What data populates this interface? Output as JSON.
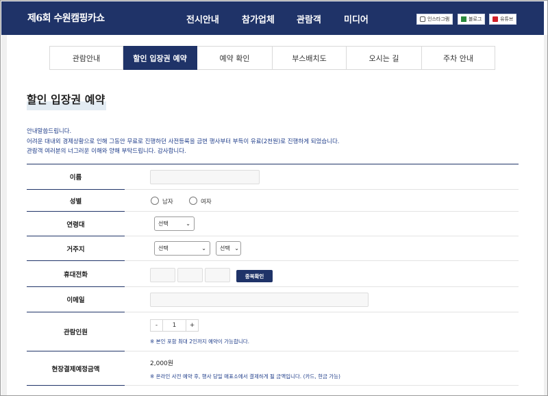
{
  "header": {
    "logo": "제6회 수원캠핑카쇼",
    "nav": [
      "전시안내",
      "참가업체",
      "관람객",
      "미디어"
    ],
    "sns": [
      {
        "label": "인스타그램",
        "icon": "instagram-icon"
      },
      {
        "label": "블로그",
        "icon": "blog-icon"
      },
      {
        "label": "유튜브",
        "icon": "youtube-icon"
      }
    ]
  },
  "tabs": [
    {
      "label": "관람안내",
      "active": false
    },
    {
      "label": "할인 입장권 예약",
      "active": true
    },
    {
      "label": "예약 확인",
      "active": false
    },
    {
      "label": "부스배치도",
      "active": false
    },
    {
      "label": "오시는 길",
      "active": false
    },
    {
      "label": "주차 안내",
      "active": false
    }
  ],
  "page_title": "할인 입장권 예약",
  "notice": [
    "안내말씀드립니다.",
    "어려운 대내외 경제상황으로 인해 그동안 무료로 진행하던 사전등록을 금번 행사부터 부득이 유료(2천원)로 진행하게 되었습니다.",
    "관람객 여러분의 너그러운 이해와 양해 부탁드립니다. 감사합니다."
  ],
  "form": {
    "name_label": "이름",
    "gender_label": "성별",
    "gender_options": [
      "남자",
      "여자"
    ],
    "age_label": "연령대",
    "age_value": "선택",
    "address_label": "거주지",
    "address_city": "선택",
    "address_district": "선택",
    "phone_label": "휴대전화",
    "dup_check": "중복확인",
    "email_label": "이메일",
    "visitors_label": "관람인원",
    "visitors_minus": "-",
    "visitors_value": "1",
    "visitors_plus": "+",
    "visitors_note": "※ 본인 포함 최대 2인까지 예약이 가능합니다.",
    "payment_label": "현장결제예정금액",
    "payment_value": "2,000원",
    "payment_note": "※ 온라인 사전 예약 후, 행사 당일 매표소에서 결제하게 될 금액입니다. (카드, 현금 가능)"
  },
  "colors": {
    "primary": "#1f3368",
    "notice_text": "#1f3d8a"
  }
}
